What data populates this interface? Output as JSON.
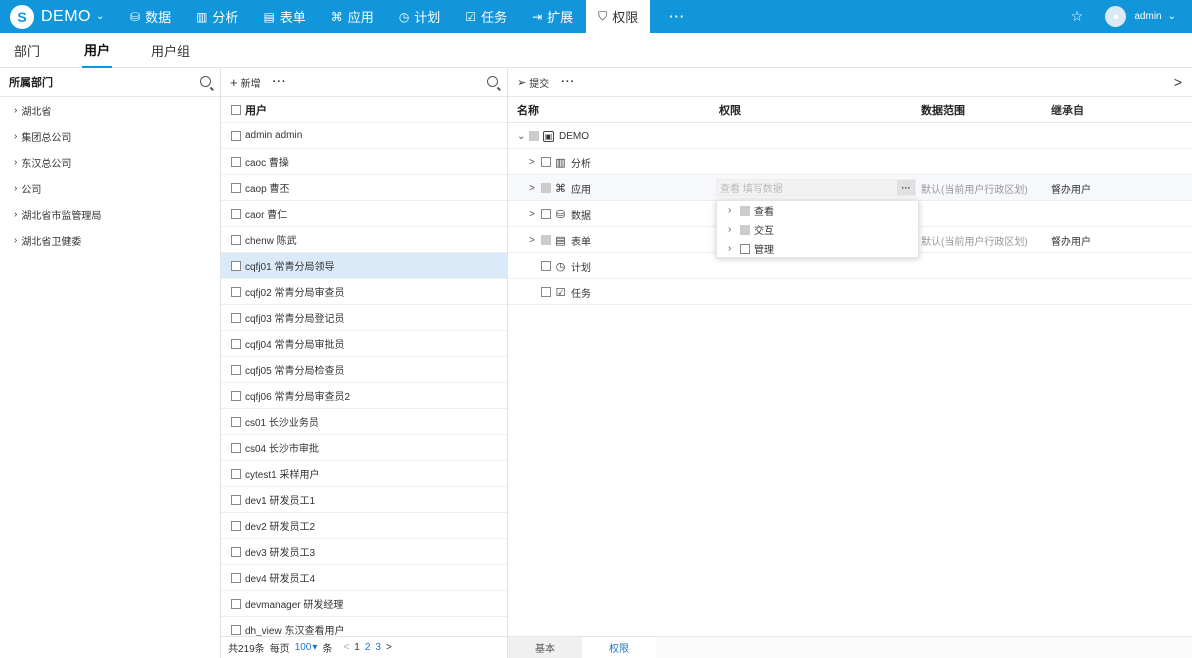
{
  "app": {
    "logo_letter": "S",
    "name": "DEMO"
  },
  "nav": [
    {
      "icon": "⛁",
      "label": "数据",
      "active": false
    },
    {
      "icon": "▥",
      "label": "分析",
      "active": false
    },
    {
      "icon": "▤",
      "label": "表单",
      "active": false
    },
    {
      "icon": "⌘",
      "label": "应用",
      "active": false
    },
    {
      "icon": "◷",
      "label": "计划",
      "active": false
    },
    {
      "icon": "☑",
      "label": "任务",
      "active": false
    },
    {
      "icon": "⇥",
      "label": "扩展",
      "active": false
    },
    {
      "icon": "⛉",
      "label": "权限",
      "active": true
    }
  ],
  "nav_more": "···",
  "user": {
    "name": "admin"
  },
  "subtabs": [
    "部门",
    "用户",
    "用户组"
  ],
  "departments": {
    "header": "所属部门",
    "items": [
      "湖北省",
      "集团总公司",
      "东汉总公司",
      "公司",
      "湖北省市监管理局",
      "湖北省卫健委"
    ]
  },
  "users": {
    "toolbar": {
      "add_label": "新增",
      "more": "···"
    },
    "header": "用户",
    "rows": [
      "admin admin",
      "caoc 曹操",
      "caop 曹丕",
      "caor 曹仁",
      "chenw 陈武",
      "cqfj01 常青分局领导",
      "cqfj02 常青分局审查员",
      "cqfj03 常青分局登记员",
      "cqfj04 常青分局审批员",
      "cqfj05 常青分局检查员",
      "cqfj06 常青分局审查员2",
      "cs01 长沙业务员",
      "cs04 长沙市审批",
      "cytest1 采样用户",
      "dev1 研发员工1",
      "dev2 研发员工2",
      "dev3 研发员工3",
      "dev4 研发员工4",
      "devmanager 研发经理",
      "dh_view 东汉查看用户"
    ],
    "selected_index": 5,
    "pager": {
      "total": "共219条",
      "per_page_label": "每页",
      "per_page": "100",
      "unit": "条",
      "prev": "<",
      "pages": [
        "1",
        "2",
        "3"
      ],
      "next": ">"
    }
  },
  "perms": {
    "toolbar": {
      "submit_label": "提交",
      "more": "···",
      "collapse": ">"
    },
    "columns": {
      "name": "名称",
      "perm": "权限",
      "scope": "数据范围",
      "inherit": "继承自"
    },
    "rows": [
      {
        "arrow": "⌄",
        "icon": "▣",
        "name": "DEMO",
        "scope": "",
        "inherit": ""
      },
      {
        "arrow": ">",
        "icon": "▥",
        "name": "分析",
        "scope": "",
        "inherit": ""
      },
      {
        "arrow": ">",
        "icon": "⌘",
        "name": "应用",
        "scope": "默认(当前用户行政区划)",
        "inherit": "督办用户"
      },
      {
        "arrow": ">",
        "icon": "⛁",
        "name": "数据",
        "scope": "",
        "inherit": ""
      },
      {
        "arrow": ">",
        "icon": "▤",
        "name": "表单",
        "scope": "默认(当前用户行政区划)",
        "inherit": "督办用户"
      },
      {
        "arrow": "",
        "icon": "◷",
        "name": "计划",
        "scope": "",
        "inherit": ""
      },
      {
        "arrow": "",
        "icon": "☑",
        "name": "任务",
        "scope": "",
        "inherit": ""
      }
    ],
    "perm_value": "查看 填写数据",
    "perm_more": "···",
    "popup": [
      "查看",
      "交互",
      "管理"
    ],
    "bottom_tabs": [
      "基本",
      "权限"
    ]
  }
}
